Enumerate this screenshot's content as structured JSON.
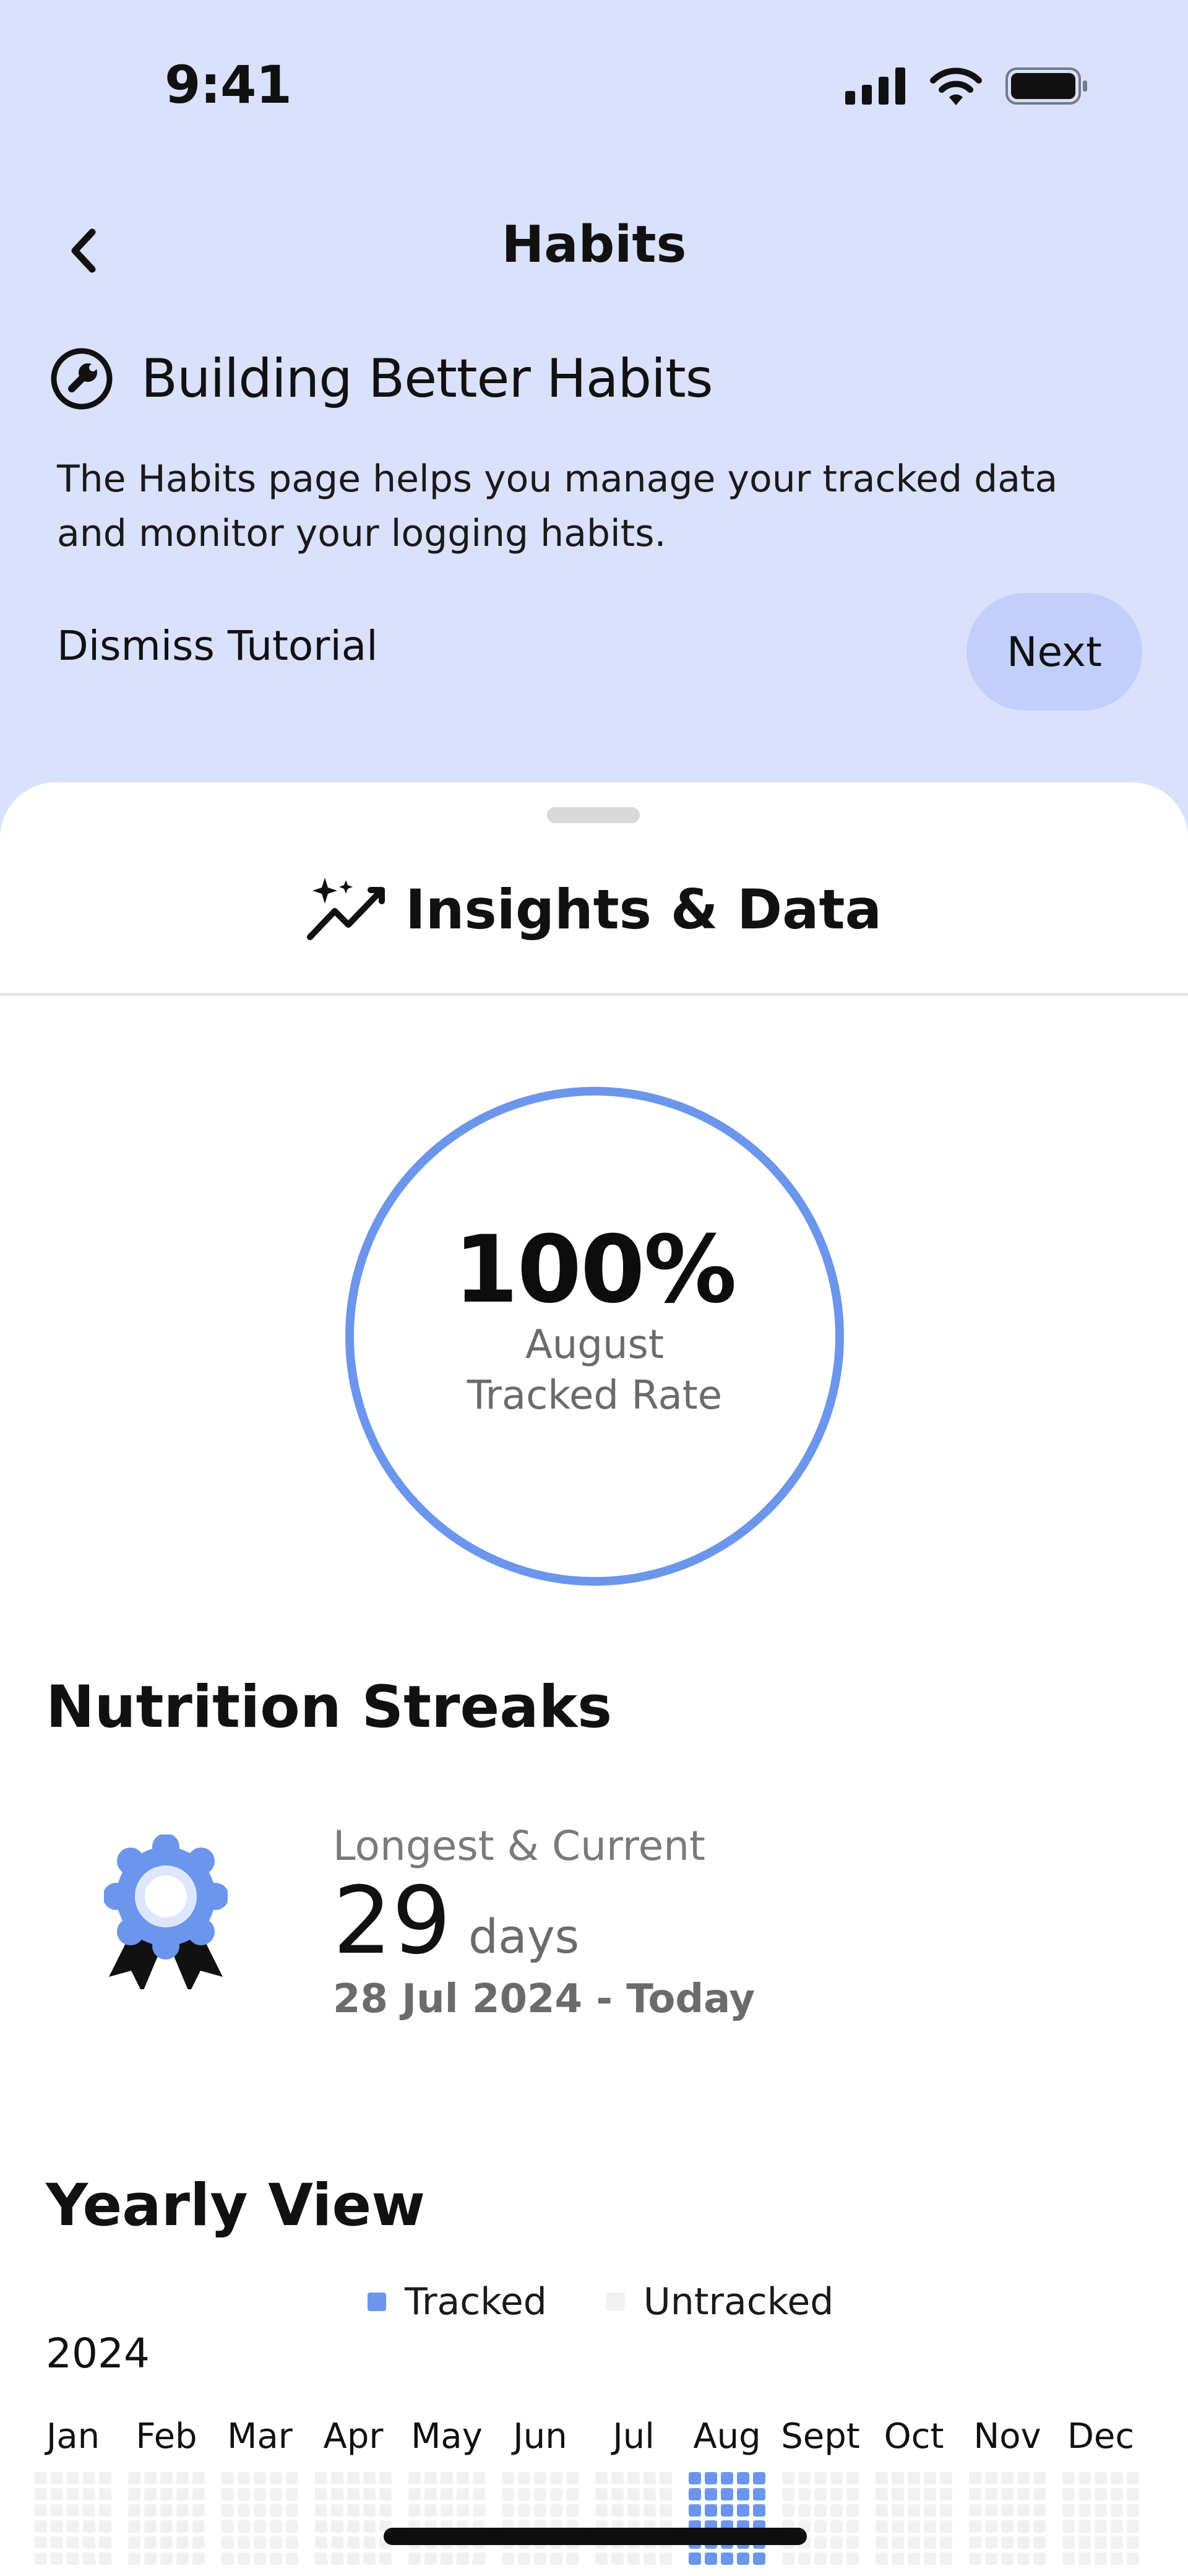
{
  "status_bar": {
    "time": "9:41"
  },
  "header": {
    "title": "Habits"
  },
  "tutorial": {
    "title": "Building Better Habits",
    "description": "The Habits page helps you manage your tracked data and monitor your logging habits.",
    "dismiss_label": "Dismiss Tutorial",
    "next_label": "Next"
  },
  "sheet": {
    "title": "Insights & Data",
    "tracked_rate": {
      "value": "100%",
      "label_line1": "August",
      "label_line2": "Tracked Rate",
      "fraction": 1.0
    }
  },
  "streaks": {
    "section_title": "Nutrition Streaks",
    "label": "Longest & Current",
    "number": "29",
    "unit": "days",
    "range": "28 Jul 2024 - Today"
  },
  "yearly": {
    "section_title": "Yearly View",
    "legend": [
      {
        "label": "Tracked",
        "color": "#6c96ec"
      },
      {
        "label": "Untracked",
        "color": "#f1f1f1"
      }
    ],
    "year": "2024",
    "months": [
      "Jan",
      "Feb",
      "Mar",
      "Apr",
      "May",
      "Jun",
      "Jul",
      "Aug",
      "Sept",
      "Oct",
      "Nov",
      "Dec"
    ],
    "tracked_month": "Aug"
  },
  "colors": {
    "accent": "#6c96ec",
    "accent_light": "#c1cffa",
    "background_top": "#d9e1fd",
    "untracked": "#f1f1f1"
  }
}
